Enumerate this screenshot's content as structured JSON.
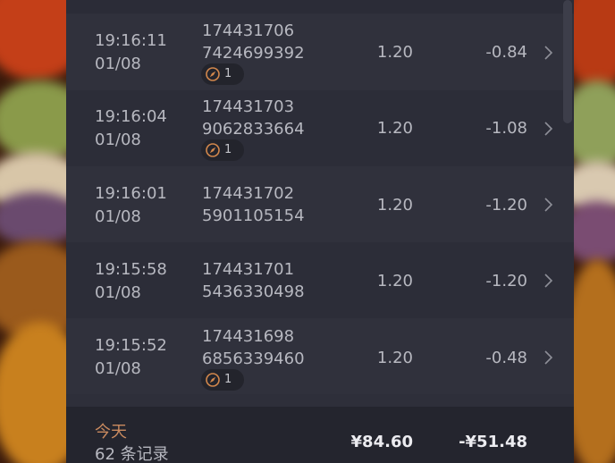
{
  "colors": {
    "panel_bg": "#2e2f3a",
    "row_alt_bg": "#30313c",
    "footer_bg": "#24252e",
    "text": "#b7b8c0",
    "accent": "#c98a5f",
    "badge_icon": "#d2874c"
  },
  "transactions": [
    {
      "time": "19:16:11",
      "date": "01/08",
      "id_line1": "174431706",
      "id_line2": "7424699392",
      "price": "1.20",
      "change": "-0.84",
      "badge_count": "1"
    },
    {
      "time": "19:16:04",
      "date": "01/08",
      "id_line1": "174431703",
      "id_line2": "9062833664",
      "price": "1.20",
      "change": "-1.08",
      "badge_count": "1"
    },
    {
      "time": "19:16:01",
      "date": "01/08",
      "id_line1": "174431702",
      "id_line2": "5901105154",
      "price": "1.20",
      "change": "-1.20"
    },
    {
      "time": "19:15:58",
      "date": "01/08",
      "id_line1": "174431701",
      "id_line2": "5436330498",
      "price": "1.20",
      "change": "-1.20"
    },
    {
      "time": "19:15:52",
      "date": "01/08",
      "id_line1": "174431698",
      "id_line2": "6856339460",
      "price": "1.20",
      "change": "-0.48",
      "badge_count": "1"
    }
  ],
  "row_icons": {
    "badge": "compass-icon",
    "detail": "chevron-right-icon"
  },
  "summary": {
    "label": "今天",
    "count": "62 条记录",
    "total": "¥84.60",
    "change": "-¥51.48"
  }
}
